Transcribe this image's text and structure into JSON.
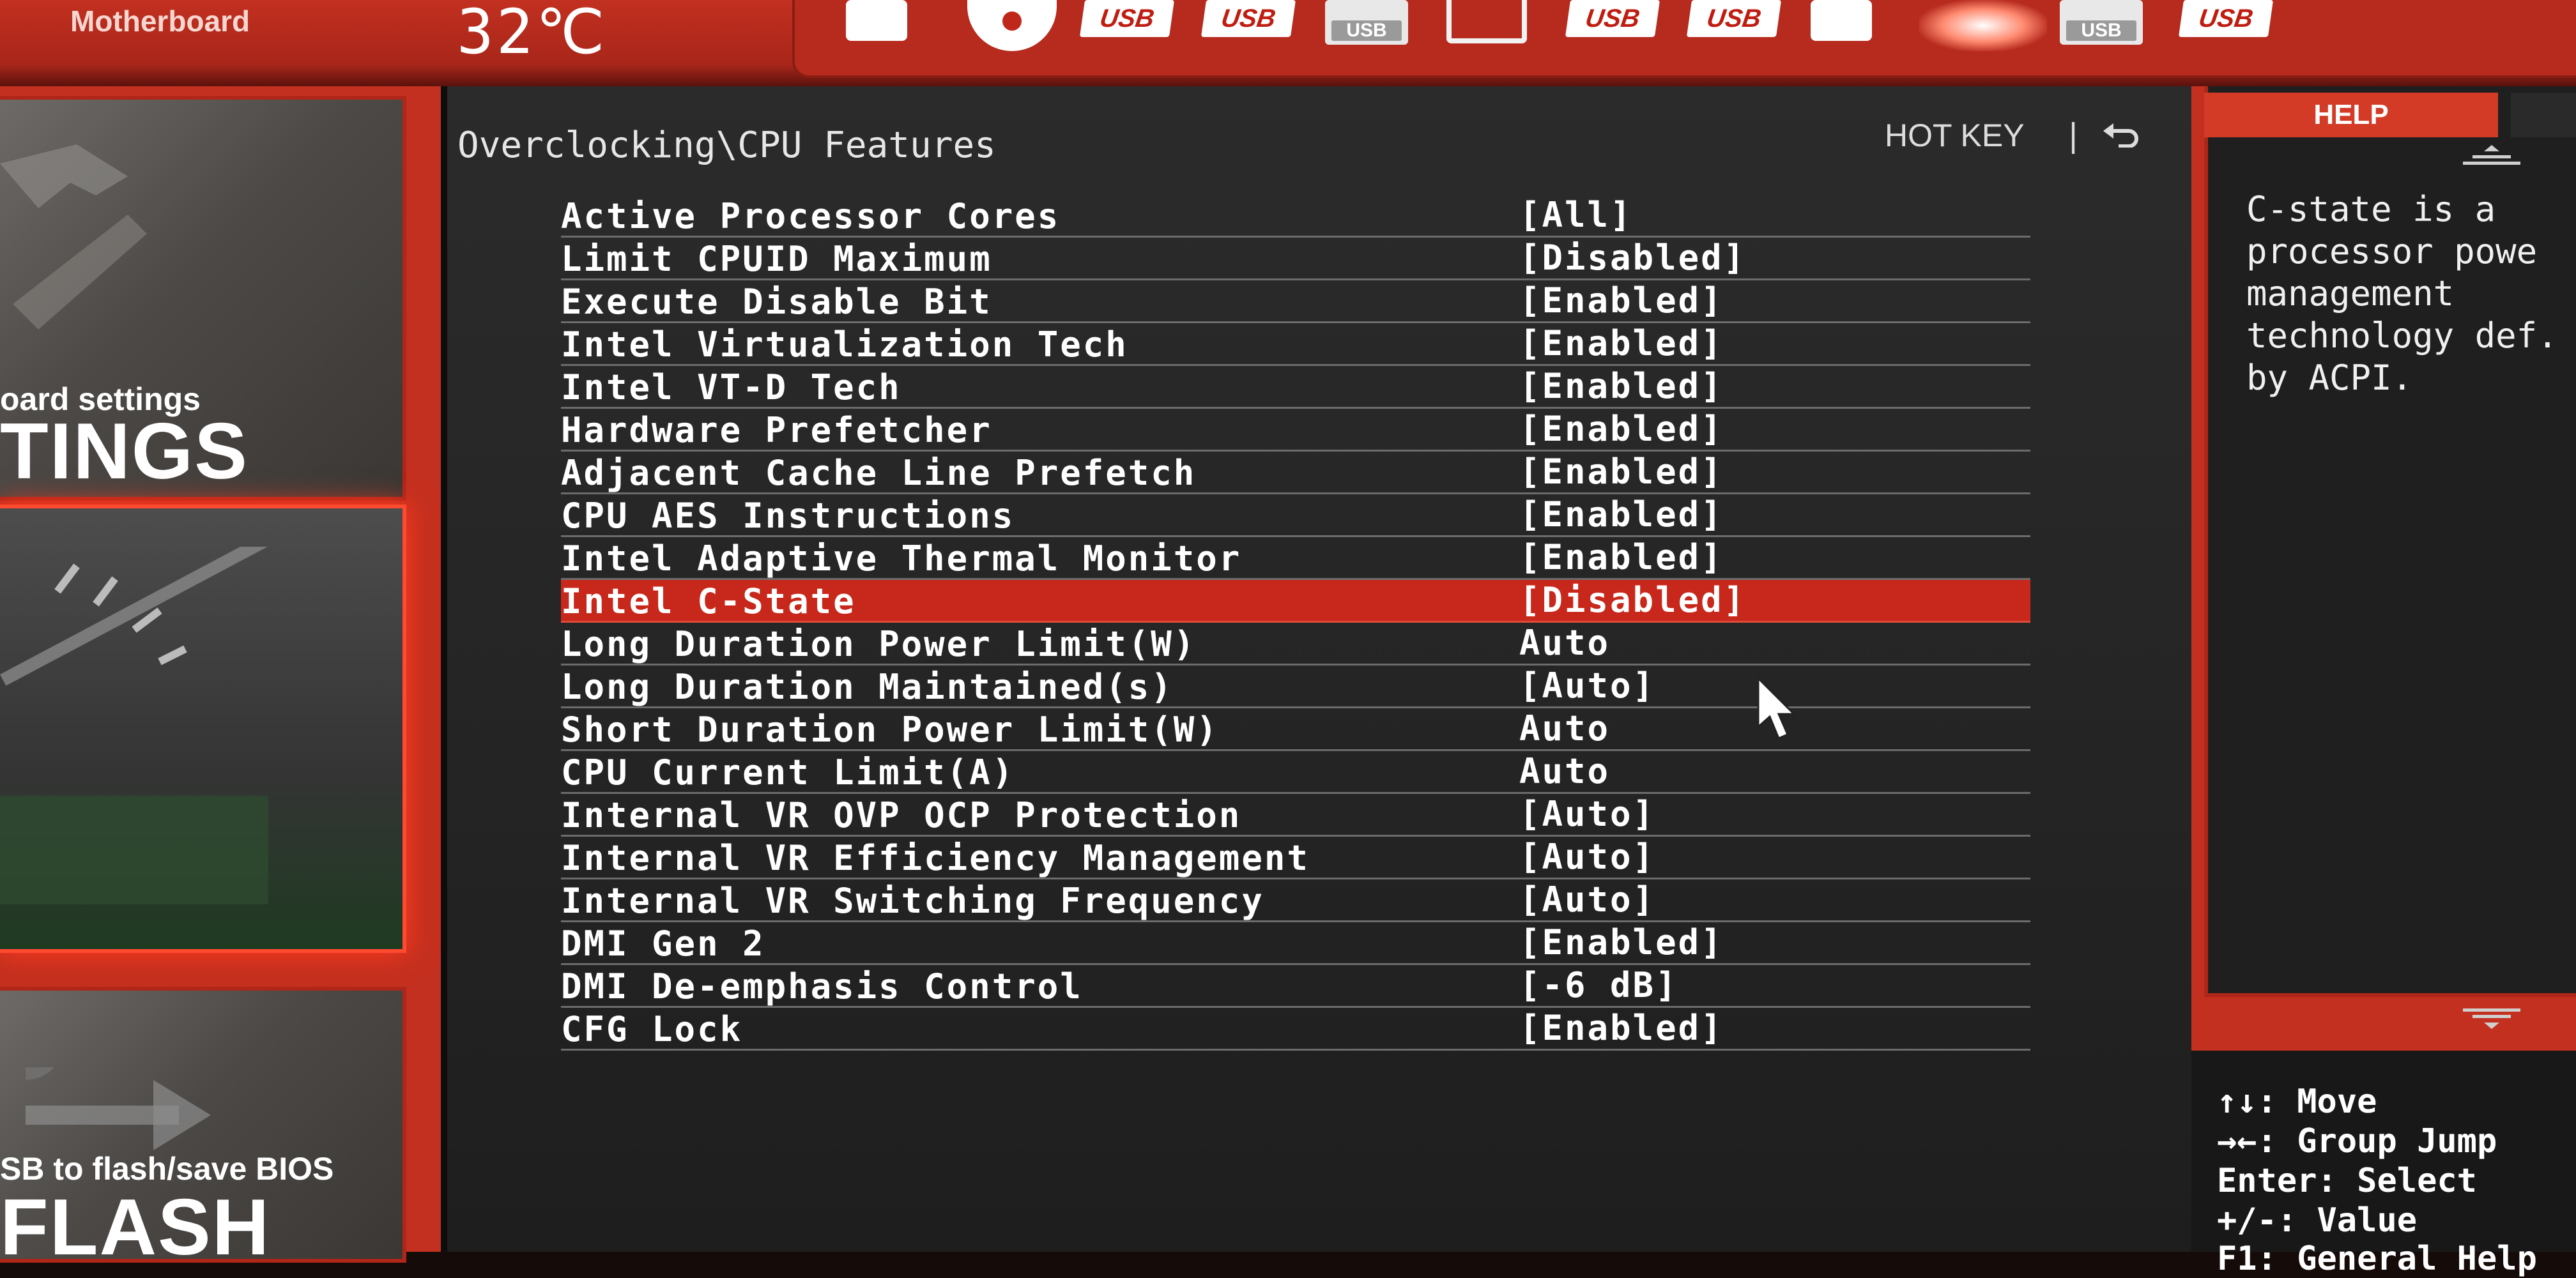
{
  "header": {
    "motherboard_label": "Motherboard",
    "temperature": "32℃",
    "boot_devices": [
      {
        "type": "card",
        "label": ""
      },
      {
        "type": "disc",
        "label": ""
      },
      {
        "type": "usb",
        "label": "USB"
      },
      {
        "type": "usb",
        "label": "USB"
      },
      {
        "type": "usb-box",
        "label": "USB"
      },
      {
        "type": "hdd",
        "label": ""
      },
      {
        "type": "usb",
        "label": "USB"
      },
      {
        "type": "usb",
        "label": "USB"
      },
      {
        "type": "card",
        "label": ""
      },
      {
        "type": "glow",
        "label": ""
      },
      {
        "type": "usb-box",
        "label": "USB"
      },
      {
        "type": "usb",
        "label": "USB"
      }
    ]
  },
  "sidebar": {
    "settings": {
      "subtitle": "oard settings",
      "title": "TINGS"
    },
    "oc": {
      "subtitle": "",
      "title": ""
    },
    "mflash": {
      "subtitle": "SB to flash/save BIOS",
      "title": "FLASH"
    }
  },
  "main": {
    "breadcrumb": "Overclocking\\CPU Features",
    "hotkey_label": "HOT KEY",
    "hotkey_separator": "|",
    "selected_index": 9,
    "rows": [
      {
        "label": "Active Processor Cores",
        "value": "[All]"
      },
      {
        "label": "Limit CPUID Maximum",
        "value": "[Disabled]"
      },
      {
        "label": "Execute Disable Bit",
        "value": "[Enabled]"
      },
      {
        "label": "Intel Virtualization Tech",
        "value": "[Enabled]"
      },
      {
        "label": "Intel VT-D Tech",
        "value": "[Enabled]"
      },
      {
        "label": "Hardware Prefetcher",
        "value": "[Enabled]"
      },
      {
        "label": "Adjacent Cache Line Prefetch",
        "value": "[Enabled]"
      },
      {
        "label": "CPU AES Instructions",
        "value": "[Enabled]"
      },
      {
        "label": "Intel Adaptive Thermal Monitor",
        "value": "[Enabled]"
      },
      {
        "label": "Intel C-State",
        "value": "[Disabled]"
      },
      {
        "label": "Long Duration Power Limit(W)",
        "value": "Auto"
      },
      {
        "label": "Long Duration Maintained(s)",
        "value": "[Auto]"
      },
      {
        "label": "Short Duration Power Limit(W)",
        "value": "Auto"
      },
      {
        "label": "CPU Current Limit(A)",
        "value": "Auto"
      },
      {
        "label": "Internal VR OVP OCP Protection",
        "value": "[Auto]"
      },
      {
        "label": "Internal VR Efficiency Management",
        "value": "[Auto]"
      },
      {
        "label": "Internal VR Switching Frequency",
        "value": "[Auto]"
      },
      {
        "label": "DMI Gen 2",
        "value": "[Enabled]"
      },
      {
        "label": "DMI De-emphasis Control",
        "value": "[-6 dB]"
      },
      {
        "label": "CFG Lock",
        "value": "[Enabled]"
      }
    ]
  },
  "help": {
    "tab_label": "HELP",
    "text": "C-state is a\nprocessor powe\nmanagement\ntechnology def.\nby ACPI.",
    "keys": [
      "↑↓: Move",
      "→←: Group Jump",
      "Enter: Select",
      "+/-: Value",
      "F1: General Help"
    ]
  },
  "colors": {
    "accent_red": "#c4301f",
    "selected_row": "#c8281b",
    "panel_bg": "#262626"
  }
}
